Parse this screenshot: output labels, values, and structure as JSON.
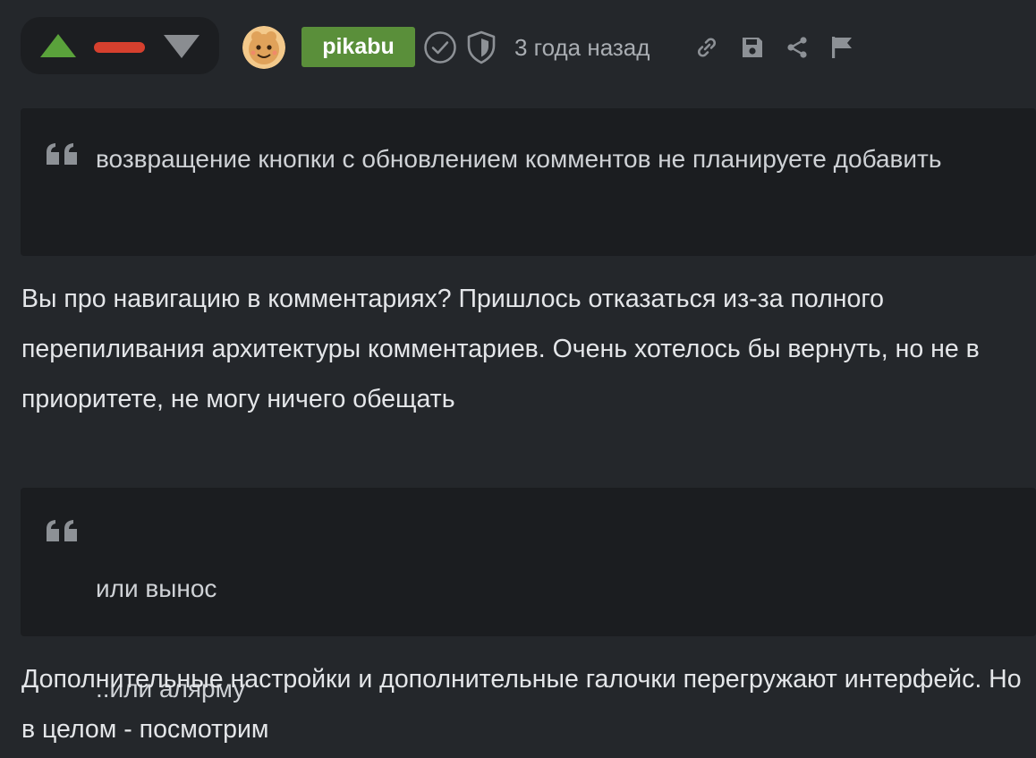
{
  "comment": {
    "author": {
      "name": "pikabu",
      "avatar_icon": "cookie-avatar-icon",
      "badge_color": "#5a8f3a"
    },
    "timestamp": "3 года назад",
    "votes": {
      "up_color": "#5aa23b",
      "bar_color": "#d6402e",
      "down_color": "#8a8d91"
    },
    "header_icons": [
      "verified-check-icon",
      "shield-icon",
      "link-icon",
      "save-icon",
      "share-icon",
      "flag-icon"
    ],
    "blocks": {
      "quote1": "возвращение кнопки с обновлением комментов не планируете добавить",
      "reply1": "Вы про навигацию в комментариях? Пришлось отказаться из-за полного перепиливания архитектуры комментариев. Очень хотелось бы вернуть, но не в приоритете, не могу ничего обещать",
      "quote2_line1": "или вынос",
      "quote2_line2": "..или алярму",
      "reply2": "Дополнительные настройки и дополнительные галочки перегружают интерфейс. Но в целом - посмотрим"
    }
  }
}
